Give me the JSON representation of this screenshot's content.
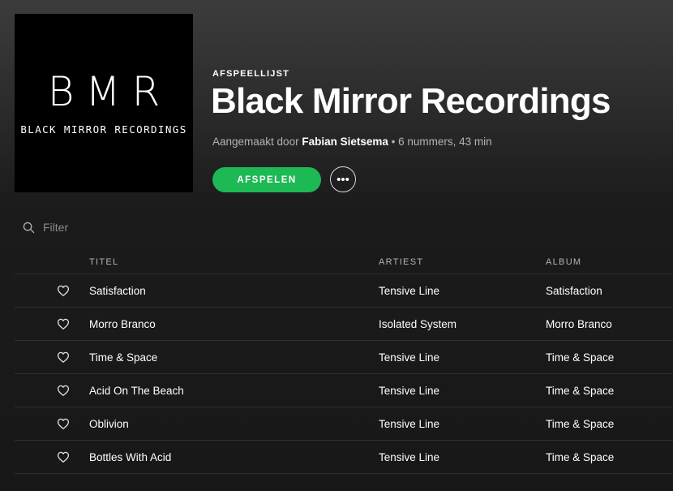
{
  "cover": {
    "logo": "BMR",
    "subtitle": "BLACK MIRROR RECORDINGS"
  },
  "header": {
    "type_label": "AFSPEELLIJST",
    "title": "Black Mirror Recordings",
    "created_by_prefix": "Aangemaakt door",
    "owner": "Fabian Sietsema",
    "summary": "6 nummers, 43 min"
  },
  "actions": {
    "play_label": "AFSPELEN",
    "more_label": "•••"
  },
  "filter": {
    "placeholder": "Filter"
  },
  "columns": {
    "title": "TITEL",
    "artist": "ARTIEST",
    "album": "ALBUM"
  },
  "tracks": [
    {
      "title": "Satisfaction",
      "artist": "Tensive Line",
      "album": "Satisfaction"
    },
    {
      "title": "Morro Branco",
      "artist": "Isolated System",
      "album": "Morro Branco"
    },
    {
      "title": "Time & Space",
      "artist": "Tensive Line",
      "album": "Time & Space"
    },
    {
      "title": "Acid On The Beach",
      "artist": "Tensive Line",
      "album": "Time & Space"
    },
    {
      "title": "Oblivion",
      "artist": "Tensive Line",
      "album": "Time & Space"
    },
    {
      "title": "Bottles With Acid",
      "artist": "Tensive Line",
      "album": "Time & Space"
    }
  ],
  "colors": {
    "accent": "#1db954",
    "background": "#181818",
    "muted_text": "#b3b3b3"
  },
  "icons": {
    "filter": "search-icon",
    "row_action": "heart-icon"
  }
}
